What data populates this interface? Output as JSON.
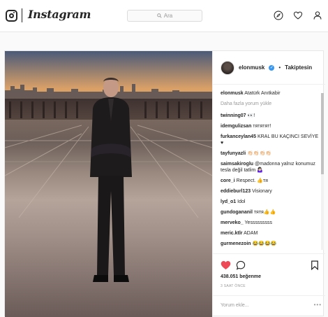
{
  "header": {
    "wordmark": "Instagram",
    "search_placeholder": "Ara"
  },
  "post": {
    "author": "elonmusk",
    "follow_label": "Takiptesin",
    "caption_user": "elonmusk",
    "caption_text": "Atatürk Anıtkabir",
    "load_more": "Daha fazla yorum yükle",
    "comments": [
      {
        "user": "twinning07",
        "text": "👀!"
      },
      {
        "user": "idemgulizsan",
        "text": "тятятят!"
      },
      {
        "user": "furkanceylan45",
        "text": "KRAL BU KAÇINCI SEVİYE ♥"
      },
      {
        "user": "tayfunyazli",
        "text": "👏🏻👏🏻👏🏻👏🏻"
      },
      {
        "user": "saimsakiroglu",
        "text": "@madonna yalnız konumuz tesla değil tatlim 🤷🏻‍♀️"
      },
      {
        "user": "core_i",
        "text": "Respect. 👍тя"
      },
      {
        "user": "eddieburl123",
        "text": "Visionary"
      },
      {
        "user": "lyd_o1",
        "text": "Idol"
      },
      {
        "user": "gundogananil",
        "text": "тятя👍👍"
      },
      {
        "user": "merveko_",
        "text": "Yesssssssss"
      },
      {
        "user": "meric.ktlr",
        "text": "ADAM"
      },
      {
        "user": "gurmenezoin",
        "text": "😂😂😂😂"
      }
    ],
    "likes": "438.051 beğenme",
    "time_ago": "3 SAAT ÖNCE",
    "comment_placeholder": "Yorum ekle...",
    "more_dots": "•••",
    "colors": {
      "heart": "#ed4956",
      "verified": "#3897f0"
    }
  }
}
